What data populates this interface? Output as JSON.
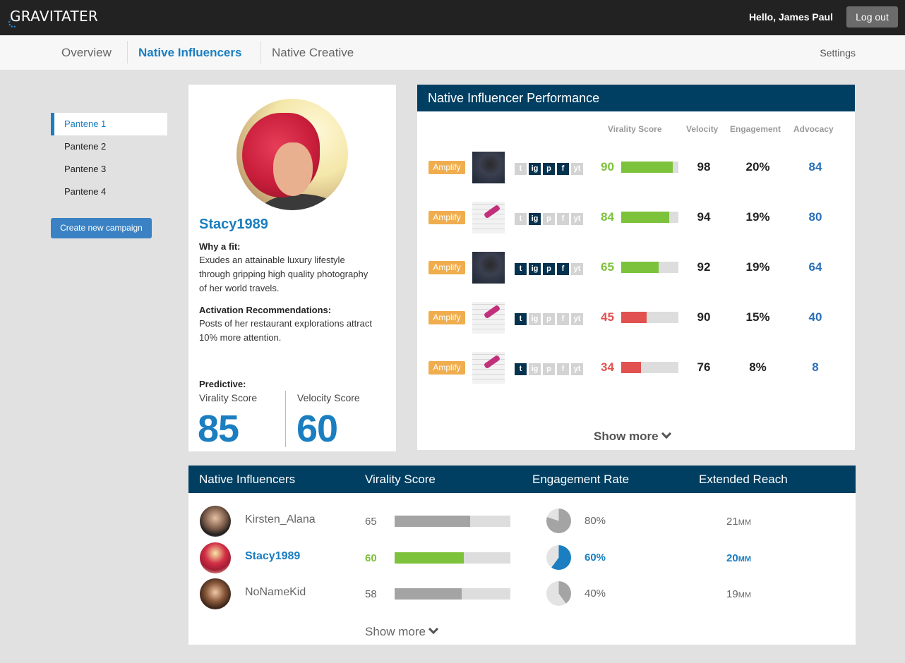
{
  "app": {
    "logo": "GRAVITATER",
    "greeting": "Hello, James Paul",
    "logout": "Log out"
  },
  "nav": {
    "tabs": [
      "Overview",
      "Native Influencers",
      "Native Creative"
    ],
    "active": "Native Influencers",
    "settings": "Settings"
  },
  "sidebar": {
    "campaigns": [
      "Pantene 1",
      "Pantene 2",
      "Pantene 3",
      "Pantene 4"
    ],
    "active": "Pantene 1",
    "create_button": "Create new campaign"
  },
  "profile": {
    "name": "Stacy1989",
    "why_fit_label": "Why a fit:",
    "why_fit_text": "Exudes an attainable luxury lifestyle through gripping high quality photography of her world travels.",
    "activation_label": "Activation Recommendations:",
    "activation_text": "Posts of her restaurant explorations attract 10% more attention.",
    "predictive_label": "Predictive:",
    "virality_label": "Virality Score",
    "virality_value": "85",
    "velocity_label": "Velocity Score",
    "velocity_value": "60"
  },
  "performance": {
    "title": "Native Influencer Performance",
    "columns": [
      "Virality Score",
      "Velocity",
      "Engagement",
      "Advocacy"
    ],
    "amplify_label": "Amplify",
    "social_glyphs": [
      "t",
      "ig",
      "p",
      "f",
      "yt"
    ],
    "rows": [
      {
        "thumb": "hair",
        "socials": [
          false,
          true,
          true,
          true,
          false
        ],
        "virality": "90",
        "virality_pct": 0.9,
        "color": "#7dc23b",
        "velocity": "98",
        "engagement": "20%",
        "advocacy": "84"
      },
      {
        "thumb": "keys",
        "socials": [
          false,
          true,
          false,
          false,
          false
        ],
        "virality": "84",
        "virality_pct": 0.84,
        "color": "#7dc23b",
        "velocity": "94",
        "engagement": "19%",
        "advocacy": "80"
      },
      {
        "thumb": "hair",
        "socials": [
          true,
          true,
          true,
          true,
          false
        ],
        "virality": "65",
        "virality_pct": 0.65,
        "color": "#7dc23b",
        "velocity": "92",
        "engagement": "19%",
        "advocacy": "64"
      },
      {
        "thumb": "keys",
        "socials": [
          true,
          false,
          false,
          false,
          false
        ],
        "virality": "45",
        "virality_pct": 0.45,
        "color": "#e0514f",
        "velocity": "90",
        "engagement": "15%",
        "advocacy": "40"
      },
      {
        "thumb": "keys",
        "socials": [
          true,
          false,
          false,
          false,
          false
        ],
        "virality": "34",
        "virality_pct": 0.34,
        "color": "#e0514f",
        "velocity": "76",
        "engagement": "8%",
        "advocacy": "8"
      }
    ],
    "show_more": "Show more"
  },
  "influencers": {
    "columns": [
      "Native Influencers",
      "Virality Score",
      "Engagement Rate",
      "Extended Reach"
    ],
    "rows": [
      {
        "name": "Kirsten_Alana",
        "score": "65",
        "score_pct": 0.65,
        "engagement": "80%",
        "engagement_pct": 0.8,
        "reach": "21",
        "reach_unit": "MM",
        "highlight": false
      },
      {
        "name": "Stacy1989",
        "score": "60",
        "score_pct": 0.6,
        "engagement": "60%",
        "engagement_pct": 0.6,
        "reach": "20",
        "reach_unit": "MM",
        "highlight": true
      },
      {
        "name": "NoNameKid",
        "score": "58",
        "score_pct": 0.58,
        "engagement": "40%",
        "engagement_pct": 0.4,
        "reach": "19",
        "reach_unit": "MM",
        "highlight": false
      }
    ],
    "show_more": "Show more"
  }
}
